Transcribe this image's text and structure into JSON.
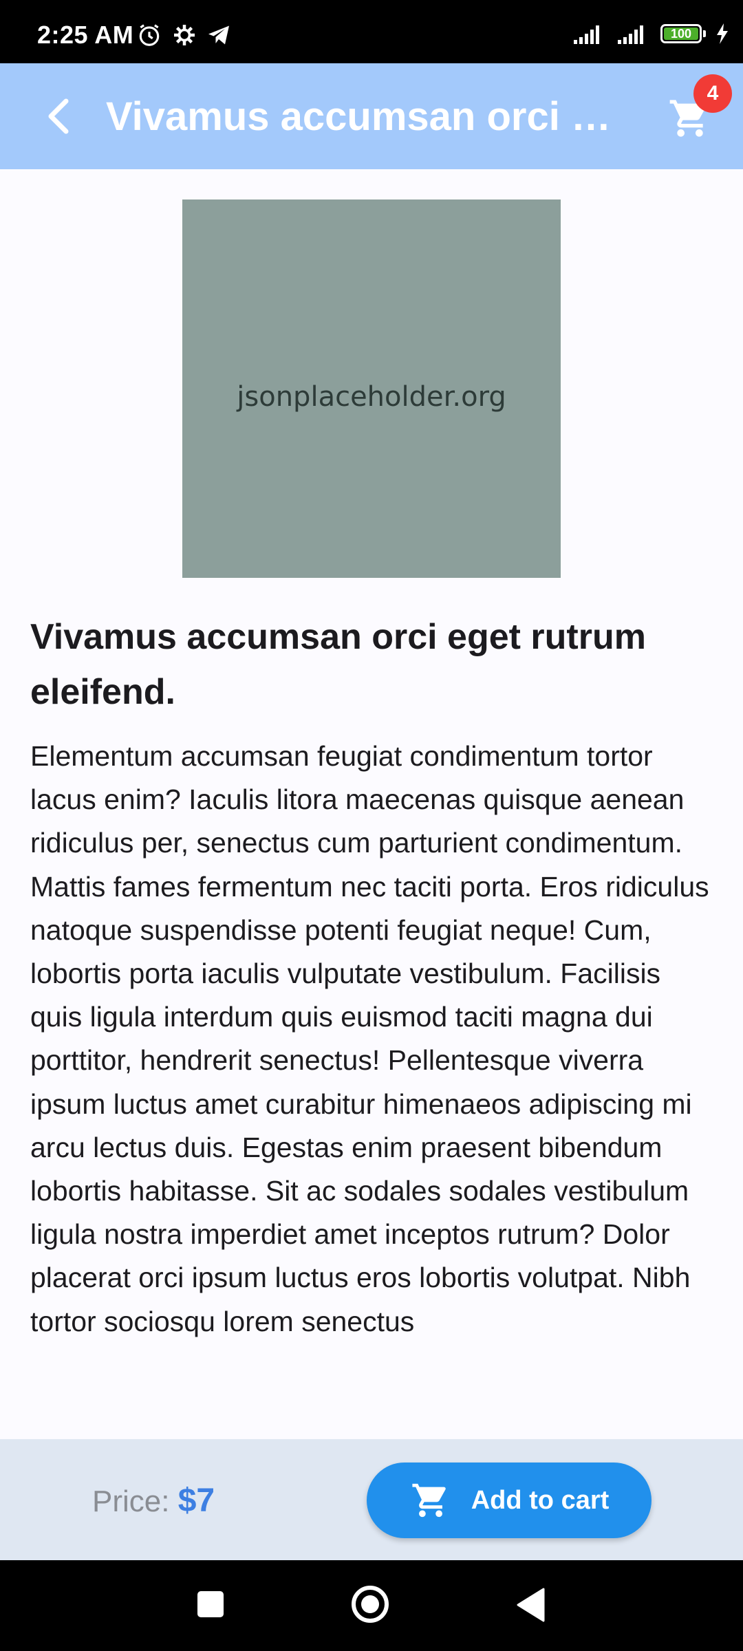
{
  "status_bar": {
    "time": "2:25 AM",
    "battery_level": "100",
    "icons": [
      "alarm-icon",
      "settings-icon",
      "telegram-icon",
      "signal-icon",
      "signal-icon",
      "battery-icon",
      "charging-icon"
    ]
  },
  "app_bar": {
    "title": "Vivamus accumsan orci eget rutrum eleifend.",
    "cart_count": "4",
    "background": "#a3c9fb"
  },
  "product": {
    "image_text": "jsonplaceholder.org",
    "title": "Vivamus accumsan orci eget rutrum eleifend.",
    "description": "Elementum accumsan feugiat condimentum tortor lacus enim? Iaculis litora maecenas quisque aenean ridiculus per, senectus cum parturient condimentum. Mattis fames fermentum nec taciti porta. Eros ridiculus natoque suspendisse potenti feugiat neque! Cum, lobortis porta iaculis vulputate vestibulum. Facilisis quis ligula interdum quis euismod taciti magna dui porttitor, hendrerit senectus! Pellentesque viverra ipsum luctus amet curabitur himenaeos adipiscing mi arcu lectus duis. Egestas enim praesent bibendum lobortis habitasse. Sit ac sodales sodales vestibulum ligula nostra imperdiet amet inceptos rutrum? Dolor placerat orci ipsum luctus eros lobortis volutpat. Nibh tortor sociosqu lorem senectus"
  },
  "bottom_bar": {
    "price_label": "Price:",
    "price_value": "$7",
    "add_to_cart_label": "Add to cart",
    "accent": "#2190ec"
  }
}
